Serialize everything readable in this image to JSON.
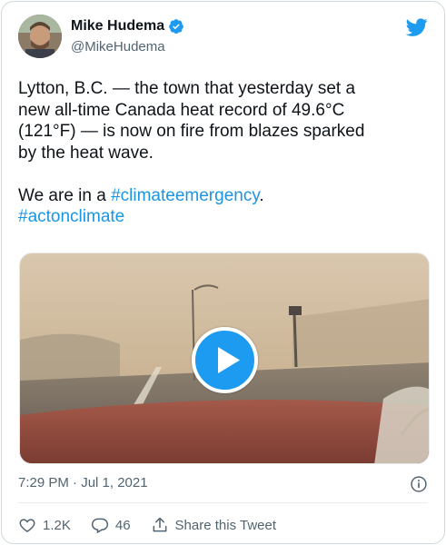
{
  "author": {
    "display_name": "Mike Hudema",
    "handle": "@MikeHudema"
  },
  "tweet": {
    "text_line1": "Lytton, B.C. — the town that yesterday set a",
    "text_line2": "new all-time Canada heat record of 49.6°C",
    "text_line3": "(121°F) — is now on fire from blazes sparked",
    "text_line4": "by the heat wave.",
    "text_pre_tag": "We are in a ",
    "hashtag1": "#climateemergency",
    "text_post_tag": ".",
    "hashtag2": "#actonclimate"
  },
  "media": {
    "type": "video"
  },
  "meta": {
    "timestamp": "7:29 PM · Jul 1, 2021"
  },
  "actions": {
    "likes": "1.2K",
    "replies": "46",
    "share_label": "Share this Tweet"
  },
  "colors": {
    "brand_blue": "#1d9bf0",
    "hashtag": "#1b95e0",
    "secondary_text": "#536471"
  }
}
